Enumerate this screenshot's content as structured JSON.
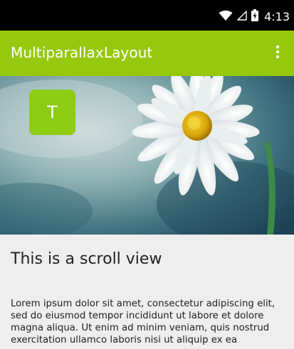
{
  "status_bar": {
    "time": "4:13",
    "icons": [
      "wifi-icon",
      "cellular-signal-icon",
      "battery-charging-icon"
    ]
  },
  "app_bar": {
    "title": "MultiparallaxLayout",
    "overflow_icon": "more-vert-icon"
  },
  "header": {
    "image": "daisy-flower-image",
    "avatar_letter": "T"
  },
  "content": {
    "title": "This is a scroll view",
    "body": "Lorem ipsum dolor sit amet, consectetur adipiscing elit, sed do eiusmod tempor incididunt ut labore et dolore magna aliqua. Ut enim ad minim veniam, quis nostrud exercitation ullamco laboris nisi ut aliquip ex ea"
  },
  "colors": {
    "app_bar": "#96c80e",
    "avatar": "#8ecb13",
    "status_bar": "#000000",
    "background": "#eeeeee"
  }
}
